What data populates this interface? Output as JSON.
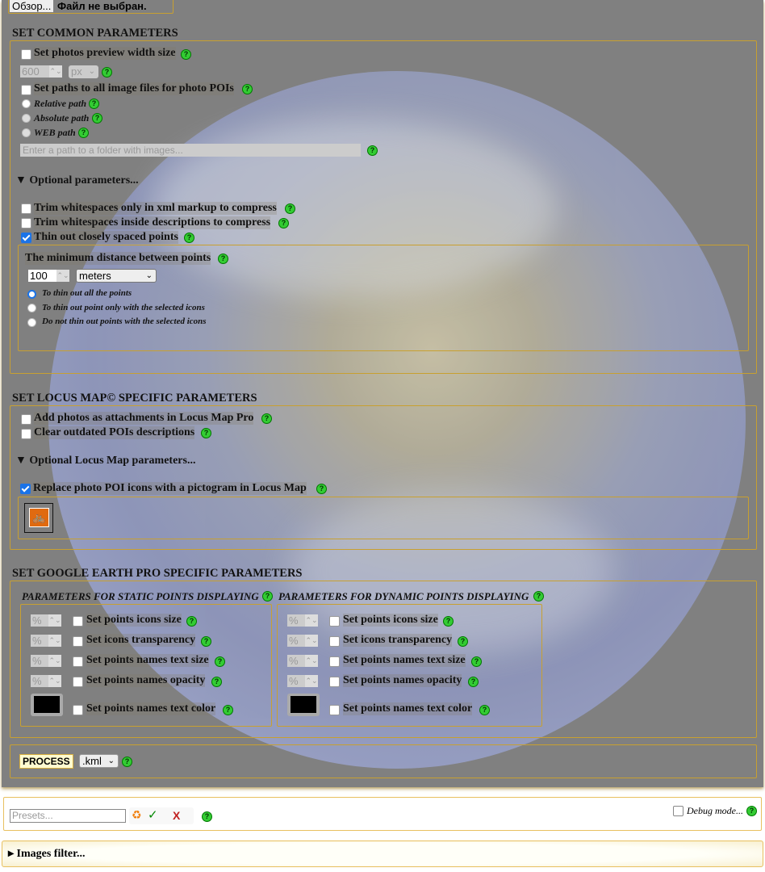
{
  "file": {
    "button": "Обзор...",
    "status": "Файл не выбран."
  },
  "common": {
    "heading": "SET COMMON PARAMETERS",
    "preview_width": {
      "label": "Set photos preview width size",
      "checked": false,
      "value": "600",
      "unit": "px"
    },
    "paths": {
      "label": "Set paths to all image files for photo POIs",
      "checked": false,
      "options": [
        "Relative path",
        "Absolute path",
        "WEB path"
      ],
      "placeholder": "Enter a path to a folder with images..."
    },
    "optional_toggle": "▼ Optional parameters...",
    "trim_xml": {
      "label": "Trim whitespaces only in xml markup to compress",
      "checked": false
    },
    "trim_desc": {
      "label": "Trim whitespaces inside descriptions to compress",
      "checked": false
    },
    "thin": {
      "label": "Thin out closely spaced points",
      "checked": true
    },
    "min_distance": {
      "label": "The minimum distance between points",
      "value": "100",
      "unit": "meters",
      "options": [
        "To thin out all the points",
        "To thin out point only with the selected icons",
        "Do not thin out points with the selected icons"
      ],
      "selected": 0
    }
  },
  "locus": {
    "heading": "SET LOCUS MAP© SPECIFIC PARAMETERS",
    "attachments": {
      "label": "Add photos as attachments in Locus Map Pro",
      "checked": false
    },
    "clear": {
      "label": "Clear outdated POIs descriptions",
      "checked": false
    },
    "optional_toggle": "▼ Optional Locus Map parameters...",
    "replace": {
      "label": "Replace photo POI icons with a pictogram in Locus Map",
      "checked": true
    },
    "pictogram_icon": "bicycle-icon",
    "pictogram_color": "#e06a10"
  },
  "google": {
    "heading": "SET GOOGLE EARTH PRO SPECIFIC PARAMETERS",
    "static": {
      "heading": "PARAMETERS FOR STATIC POINTS DISPLAYING",
      "rows": [
        "Set points icons size",
        "Set icons transparency",
        "Set points names text size",
        "Set points names opacity"
      ],
      "color_label": "Set points names text color",
      "unit": "%",
      "color": "#000000"
    },
    "dynamic": {
      "heading": "PARAMETERS FOR DYNAMIC POINTS DISPLAYING",
      "rows": [
        "Set points icons size",
        "Set icons transparency",
        "Set points names text size",
        "Set points names opacity"
      ],
      "color_label": "Set points names text color",
      "unit": "%",
      "color": "#000000"
    }
  },
  "process": {
    "button": "PROCESS",
    "format": ".kml"
  },
  "presets": {
    "placeholder": "Presets...",
    "debug_label": "Debug mode...",
    "debug_checked": false
  },
  "filter": {
    "label": "▸ Images filter..."
  },
  "help": "?"
}
